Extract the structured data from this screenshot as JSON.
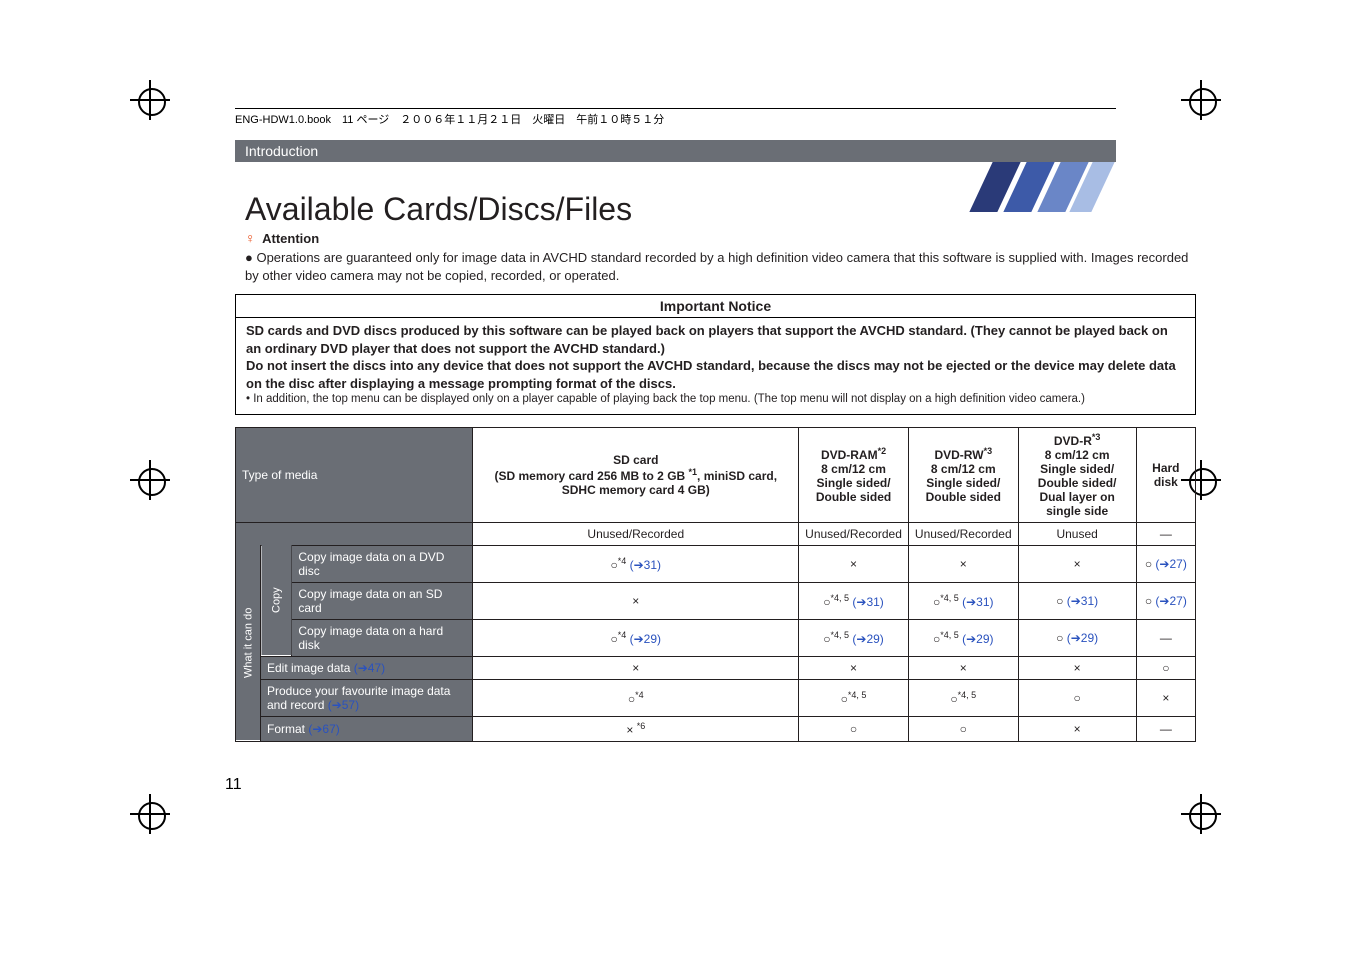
{
  "header": {
    "runner": "ENG-HDW1.0.book　11 ページ　２００６年１１月２１日　火曜日　午前１０時５１分",
    "section": "Introduction",
    "title": "Available Cards/Discs/Files"
  },
  "attention": {
    "label": "Attention",
    "body": "Operations are guaranteed only for image data in AVCHD standard recorded by a high definition video camera that this software is supplied with. Images recorded by other video camera may not be copied, recorded, or operated."
  },
  "notice": {
    "title": "Important Notice",
    "line1": "SD cards and DVD discs produced by this software can be played back on players that support the AVCHD standard. (They cannot be played back on an ordinary DVD player that does not support the AVCHD standard.)",
    "line2": "Do not insert the discs into any device that does not support the AVCHD standard, because the discs may not be ejected or the device may delete data on the disc after displaying a message prompting format of the discs.",
    "note": "In addition, the top menu can be displayed only on a player capable of playing back the top menu. (The top menu will not display on a high definition video camera.)"
  },
  "table": {
    "type_label": "Type of media",
    "col1": "SD card\n(SD memory card 256 MB to 2 GB *1, miniSD card, SDHC memory card 4 GB)",
    "col2": "DVD-RAM*2\n8 cm/12 cm\nSingle sided/\nDouble sided",
    "col3": "DVD-RW*3\n8 cm/12 cm\nSingle sided/\nDouble sided",
    "col4": "DVD-R*3\n8 cm/12 cm\nSingle sided/\nDouble sided/\nDual layer on single side",
    "col5": "Hard disk",
    "state1": "Unused/Recorded",
    "state2": "Unused/Recorded",
    "state3": "Unused/Recorded",
    "state4": "Unused",
    "state5": "—",
    "side_group": "What it can do",
    "side_copy": "Copy",
    "rows": {
      "r1": {
        "label": "Copy image data on a DVD disc",
        "c1": "○*4 (➔31)",
        "c2": "×",
        "c3": "×",
        "c4": "×",
        "c5": "○ (➔27)"
      },
      "r2": {
        "label": "Copy image data on an SD card",
        "c1": "×",
        "c2": "○*4, 5 (➔31)",
        "c3": "○*4, 5 (➔31)",
        "c4": "○ (➔31)",
        "c5": "○ (➔27)"
      },
      "r3": {
        "label": "Copy image data on a hard disk",
        "c1": "○*4 (➔29)",
        "c2": "○*4, 5 (➔29)",
        "c3": "○*4, 5 (➔29)",
        "c4": "○ (➔29)",
        "c5": "—"
      },
      "r4": {
        "label_pre": "Edit image data ",
        "label_link": "(➔47)",
        "c1": "×",
        "c2": "×",
        "c3": "×",
        "c4": "×",
        "c5": "○"
      },
      "r5": {
        "label_pre": "Produce your favourite image data and record ",
        "label_link": "(➔57)",
        "c1": "○*4",
        "c2": "○*4, 5",
        "c3": "○*4, 5",
        "c4": "○",
        "c5": "×"
      },
      "r6": {
        "label_pre": "Format ",
        "label_link": "(➔67)",
        "c1": "× *6",
        "c2": "○",
        "c3": "○",
        "c4": "×",
        "c5": "—"
      }
    }
  },
  "page_number": "11"
}
